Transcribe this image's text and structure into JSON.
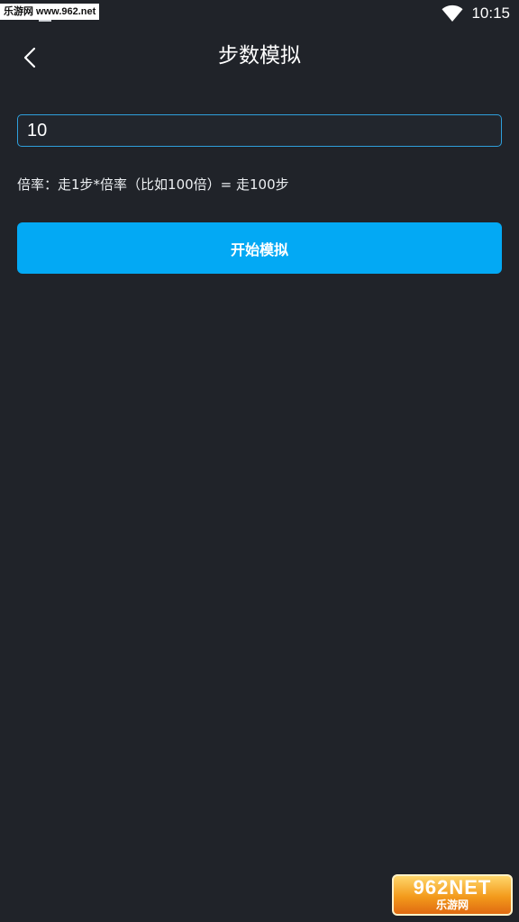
{
  "status_bar": {
    "watermark_text": "乐游网 www.962.net",
    "time": "10:15",
    "icons": [
      "notification-icon",
      "wifi-icon"
    ]
  },
  "header": {
    "back_icon": "chevron-left-icon",
    "title": "步数模拟"
  },
  "form": {
    "multiplier_value": "10",
    "hint": "倍率：走1步*倍率（比如100倍）= 走100步",
    "start_button_label": "开始模拟"
  },
  "corner_watermark": {
    "main": "962NET",
    "sub": "乐游网"
  },
  "colors": {
    "background": "#202329",
    "accent": "#03a9f4",
    "input_border": "#2f9fdc"
  }
}
